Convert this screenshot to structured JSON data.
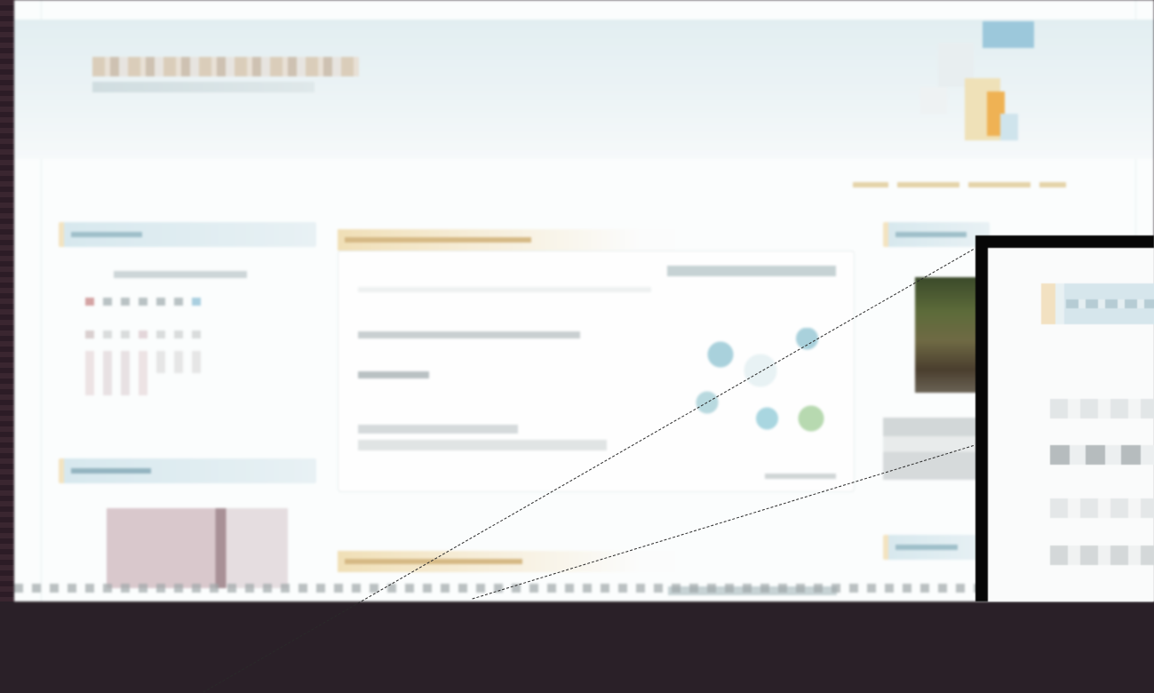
{
  "colors": {
    "page_bg": "#fbfdfd",
    "header_band": "#e2eef1",
    "accent_gold": "#f0dfb6",
    "accent_blue": "#bcd9e4",
    "zoom_frame": "#070707",
    "left_strip": "#3a2630"
  },
  "icons": {
    "logo": "site-logo-icon",
    "widget_photo": "photo-thumbnail"
  }
}
